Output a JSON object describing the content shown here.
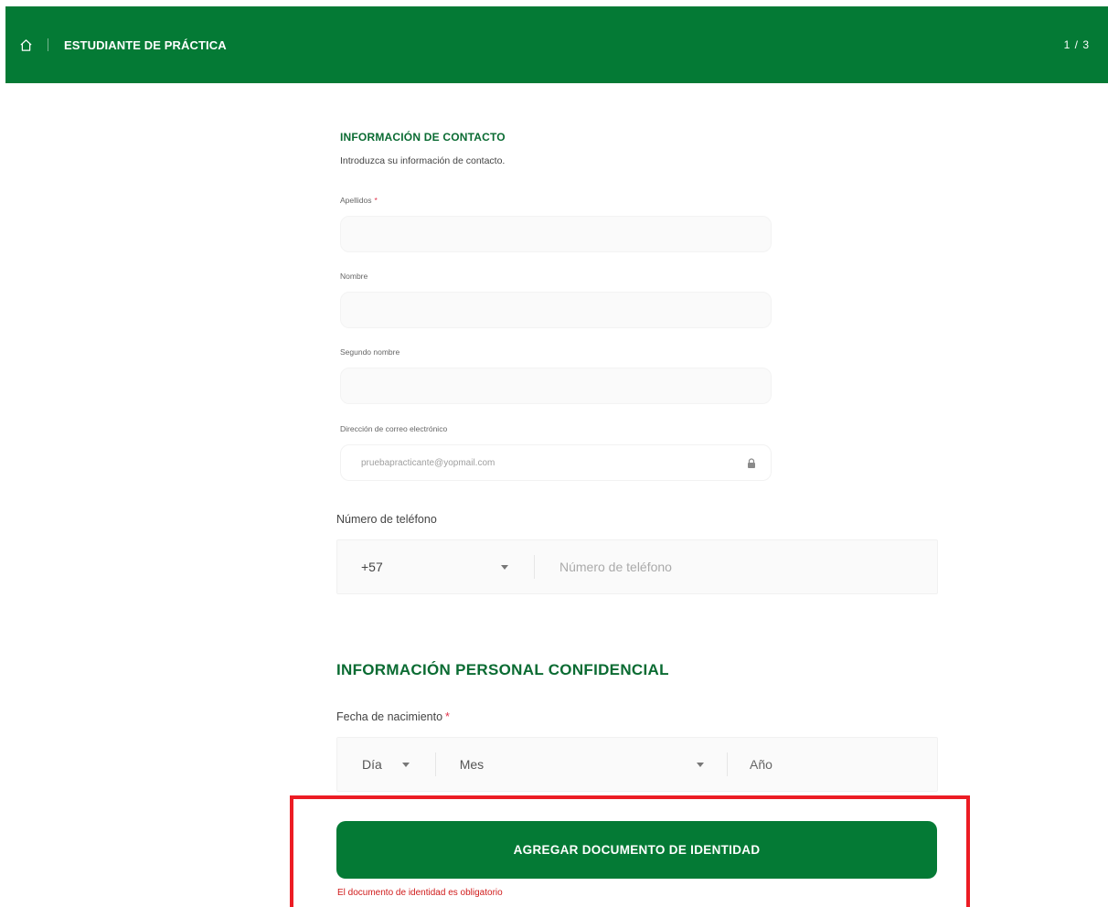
{
  "header": {
    "title": "ESTUDIANTE DE PRÁCTICA",
    "page_counter": "1 / 3",
    "home_icon": "home-icon"
  },
  "contact": {
    "title": "INFORMACIÓN DE CONTACTO",
    "subtitle": "Introduzca su información de contacto.",
    "fields": {
      "last_name": {
        "label": "Apellidos",
        "required_mark": "*",
        "value": ""
      },
      "first_name": {
        "label": "Nombre",
        "value": ""
      },
      "middle_name": {
        "label": "Segundo nombre",
        "value": ""
      },
      "email": {
        "label": "Dirección de correo electrónico",
        "value": "pruebapracticante@yopmail.com",
        "icon": "lock-icon"
      }
    }
  },
  "phone": {
    "label": "Número de teléfono",
    "country_code": "+57",
    "placeholder": "Número de teléfono"
  },
  "personal": {
    "title": "INFORMACIÓN PERSONAL CONFIDENCIAL",
    "birth_date": {
      "label": "Fecha de nacimiento",
      "required_mark": "*",
      "day_placeholder": "Día",
      "month_placeholder": "Mes",
      "year_placeholder": "Año"
    }
  },
  "identity": {
    "button_label": "AGREGAR DOCUMENTO DE IDENTIDAD",
    "error": "El documento de identidad es obligatorio"
  },
  "colors": {
    "brand_green": "#047a35",
    "heading_green": "#0a6b32",
    "error_red": "#d01b1b",
    "highlight_red": "#ec1c24"
  }
}
